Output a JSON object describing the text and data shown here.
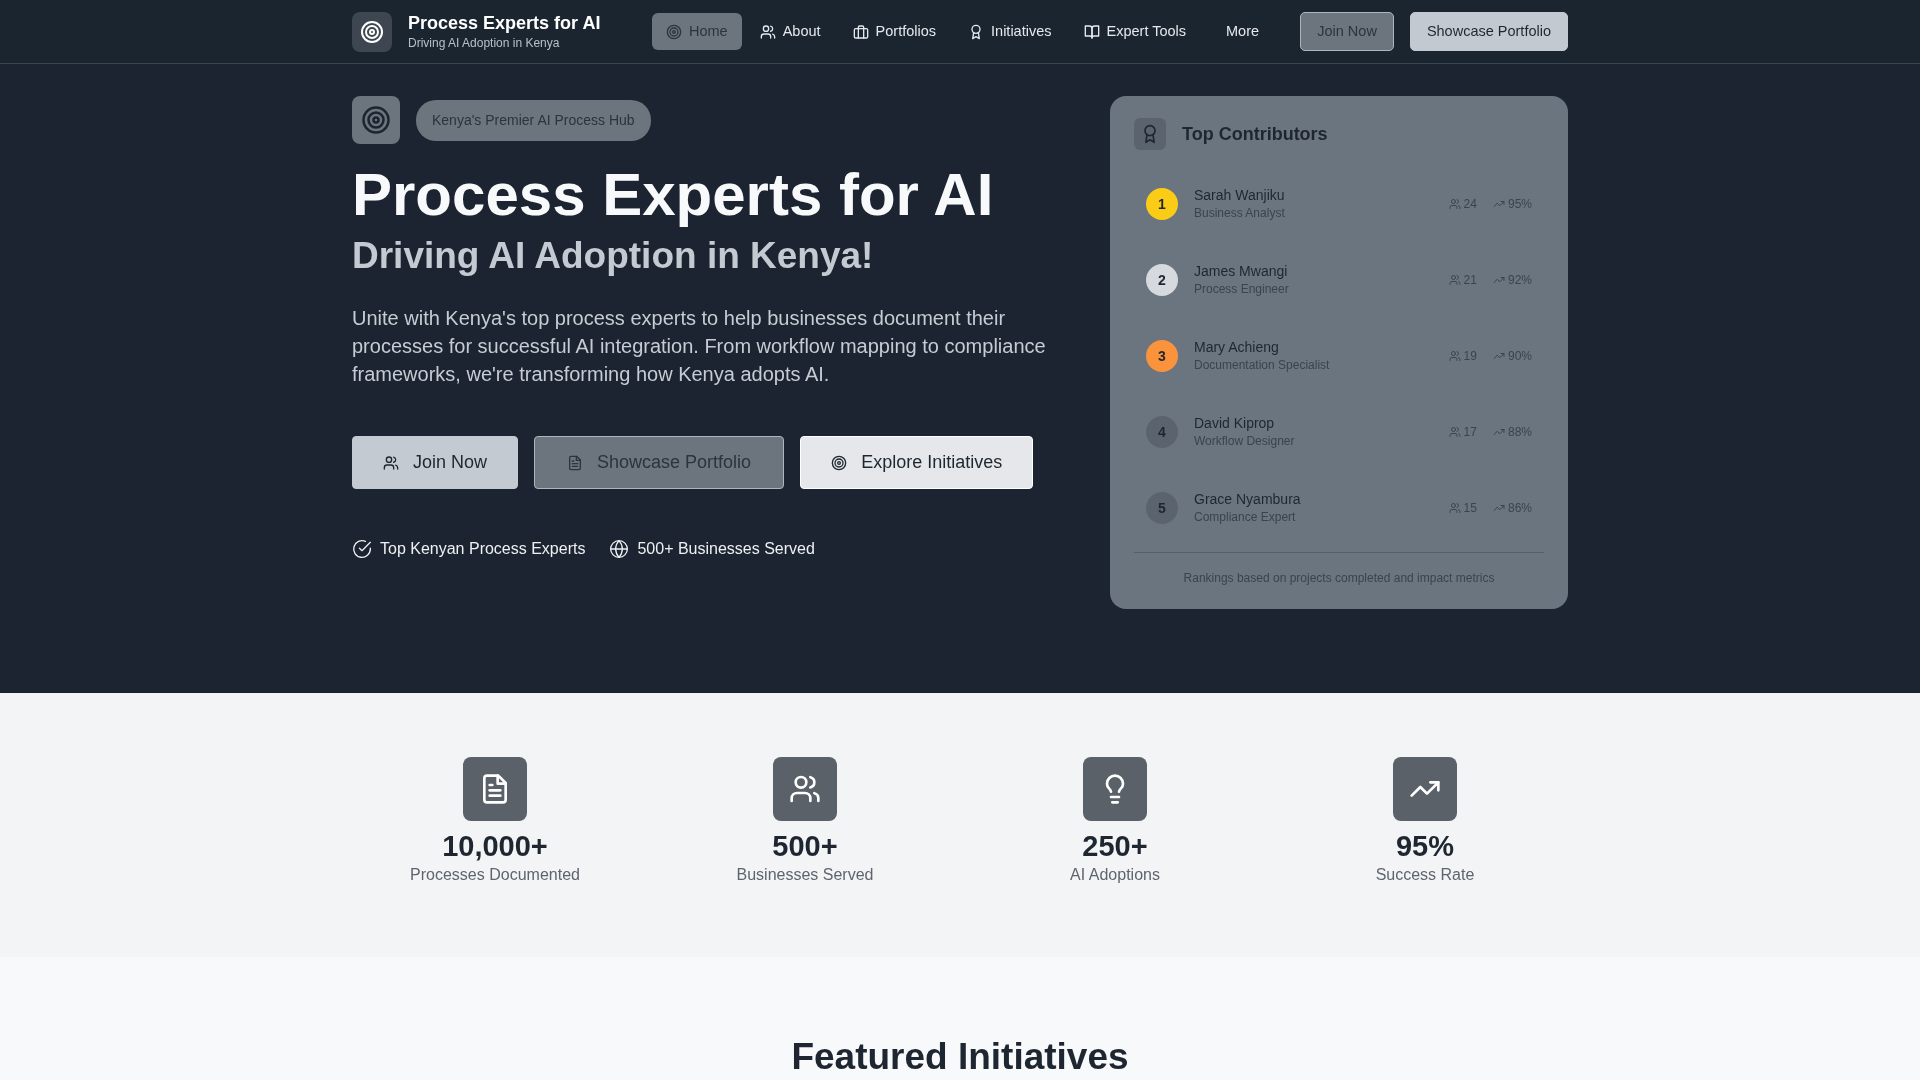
{
  "navbar": {
    "brand": {
      "title": "Process Experts for AI",
      "subtitle": "Driving AI Adoption in Kenya"
    },
    "nav_items": [
      {
        "label": "Home",
        "selected": true
      },
      {
        "label": "About",
        "selected": false
      },
      {
        "label": "Portfolios",
        "selected": false
      },
      {
        "label": "Initiatives",
        "selected": false
      },
      {
        "label": "Expert Tools",
        "selected": false
      },
      {
        "label": "More",
        "selected": false
      }
    ],
    "buttons": [
      {
        "label": "Join Now",
        "kind": "outline"
      },
      {
        "label": "Showcase Portfolio",
        "kind": "light"
      }
    ]
  },
  "hero": {
    "badge": "Kenya's Premier AI Process Hub",
    "title": "Process Experts for AI",
    "subtitle": "Driving AI Adoption in Kenya!",
    "description": "Unite with Kenya's top process experts to help businesses document their processes for successful AI integration. From workflow mapping to compliance frameworks, we're transforming how Kenya adopts AI.",
    "buttons": [
      {
        "label": "Join Now",
        "kind": "pale"
      },
      {
        "label": "Showcase Portfolio",
        "kind": "outline"
      },
      {
        "label": "Explore Initiatives",
        "kind": "light"
      }
    ],
    "features": [
      "Top Kenyan Process Experts",
      "500+ Businesses Served"
    ]
  },
  "contributors": {
    "title": "Top Contributors",
    "items": [
      {
        "rank": "1",
        "name": "Sarah Wanjiku",
        "role": "Business Analyst",
        "projects": "24",
        "rate": "95%",
        "color": "#facc15"
      },
      {
        "rank": "2",
        "name": "James Mwangi",
        "role": "Process Engineer",
        "projects": "21",
        "rate": "92%",
        "color": "#d6d9de"
      },
      {
        "rank": "3",
        "name": "Mary Achieng",
        "role": "Documentation Specialist",
        "projects": "19",
        "rate": "90%",
        "color": "#fb923c"
      },
      {
        "rank": "4",
        "name": "David Kiprop",
        "role": "Workflow Designer",
        "projects": "17",
        "rate": "88%",
        "color": "#5b646e"
      },
      {
        "rank": "5",
        "name": "Grace Nyambura",
        "role": "Compliance Expert",
        "projects": "15",
        "rate": "86%",
        "color": "#5b646e"
      }
    ],
    "footnote": "Rankings based on projects completed and impact metrics"
  },
  "stats": [
    {
      "value": "10,000+",
      "label": "Processes Documented"
    },
    {
      "value": "500+",
      "label": "Businesses Served"
    },
    {
      "value": "250+",
      "label": "AI Adoptions"
    },
    {
      "value": "95%",
      "label": "Success Rate"
    }
  ],
  "featured": {
    "title": "Featured Initiatives"
  }
}
